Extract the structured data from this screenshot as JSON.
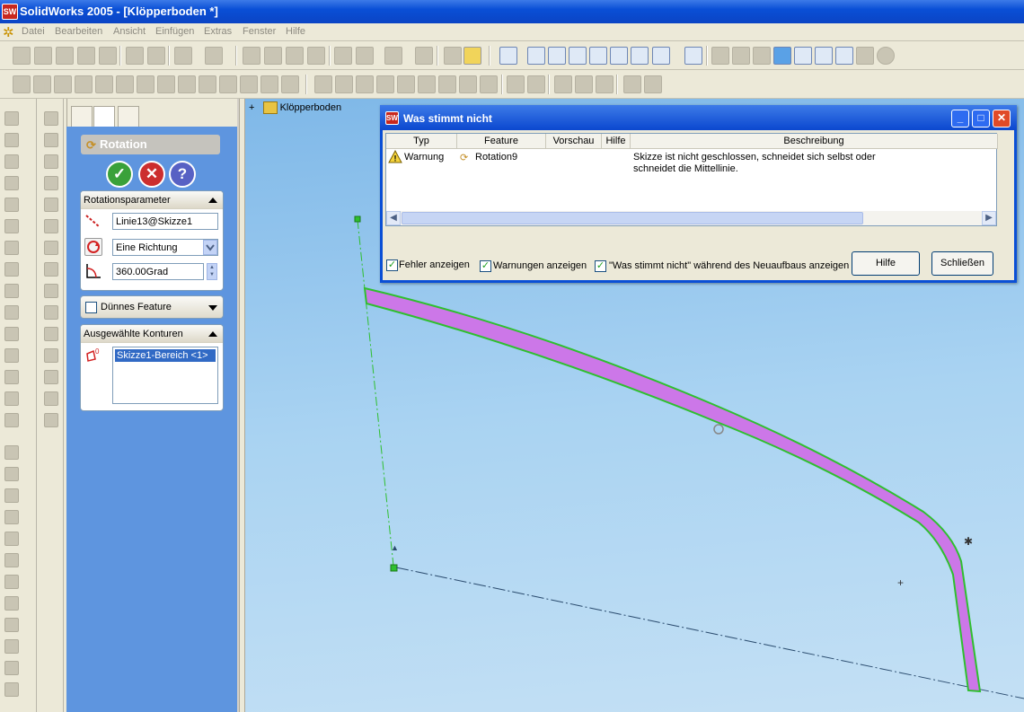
{
  "window": {
    "title": "SolidWorks 2005 - [Klöpperboden *]",
    "app_icon": "solidworks-logo"
  },
  "menu": [
    "Datei",
    "Bearbeiten",
    "Ansicht",
    "Einfügen",
    "Extras",
    "Fenster",
    "Hilfe"
  ],
  "property_manager": {
    "title": "Rotation",
    "rotation_params": {
      "label": "Rotationsparameter",
      "axis": "Linie13@Skizze1",
      "direction": "Eine Richtung",
      "angle": "360.00Grad"
    },
    "thin_feature": {
      "label": "Dünnes Feature"
    },
    "contours": {
      "label": "Ausgewählte Konturen",
      "selected": "Skizze1-Bereich <1>"
    }
  },
  "tree": {
    "root": "Klöpperboden"
  },
  "dialog": {
    "title": "Was stimmt nicht",
    "columns": [
      "Typ",
      "Feature",
      "Vorschau",
      "Hilfe",
      "Beschreibung"
    ],
    "rows": [
      {
        "type": "Warnung",
        "feature": "Rotation9",
        "preview": "",
        "help": "",
        "description_line1": "Skizze ist nicht geschlossen, schneidet sich selbst oder",
        "description_line2": "schneidet die Mittellinie."
      }
    ],
    "checkboxes": {
      "errors": "Fehler anzeigen",
      "warnings": "Warnungen anzeigen",
      "rebuild": "\"Was stimmt nicht\" während des Neuaufbaus anzeigen"
    },
    "buttons": {
      "help": "Hilfe",
      "close": "Schließen"
    }
  },
  "colors": {
    "titlebar": "#0a4fd6",
    "panel": "#5e95df",
    "profile": "#cc77e8",
    "sketch": "#2fbf2f"
  }
}
